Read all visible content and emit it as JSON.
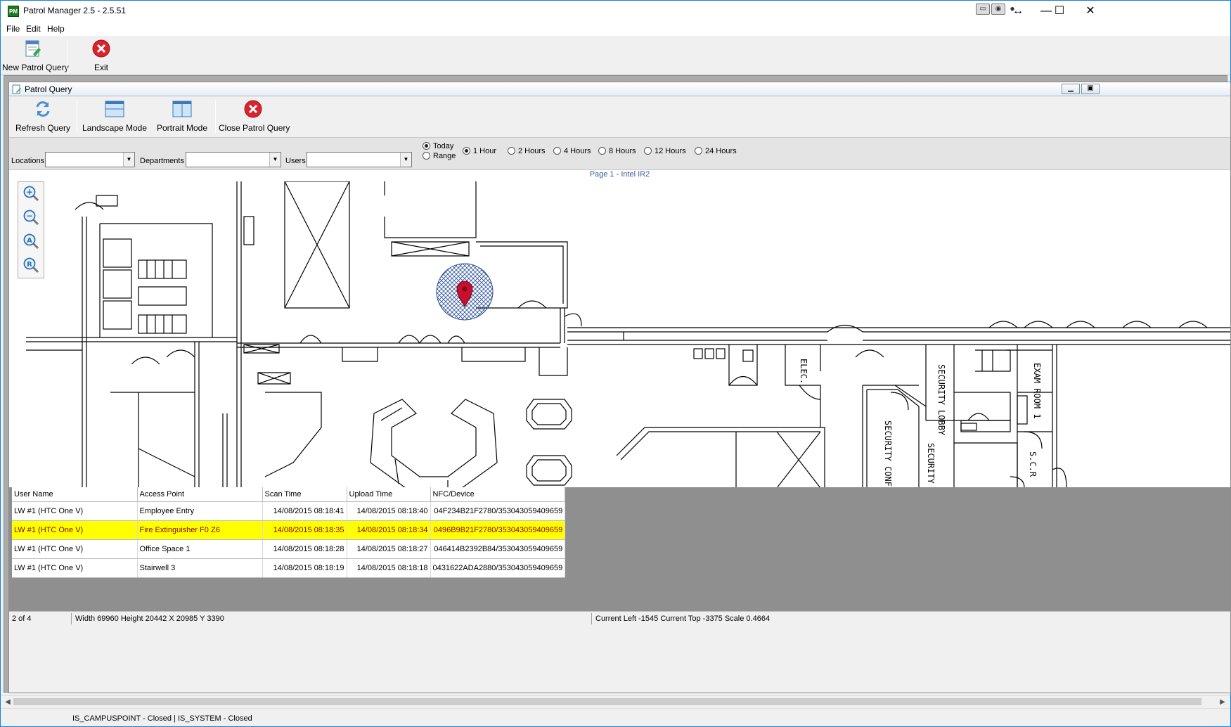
{
  "window": {
    "title": "Patrol Manager 2.5 - 2.5.51",
    "app_icon": "PM",
    "controls": {
      "minimize": "—",
      "maximize": "☐",
      "close": "✕",
      "resize": "↔"
    }
  },
  "menu": {
    "items": [
      "File",
      "Edit",
      "Help"
    ]
  },
  "main_toolbar": {
    "new_patrol_query": "New Patrol Query",
    "exit": "Exit"
  },
  "child_window": {
    "title": "Patrol Query",
    "toolbar": {
      "refresh": "Refresh Query",
      "landscape": "Landscape Mode",
      "portrait": "Portrait Mode",
      "close": "Close Patrol Query"
    },
    "filters": {
      "locations_label": "Locations",
      "locations_value": "",
      "departments_label": "Departments",
      "departments_value": "",
      "users_label": "Users",
      "users_value": "",
      "date_mode": {
        "today": "Today",
        "range": "Range",
        "selected": "Today"
      },
      "time_ranges": [
        "1 Hour",
        "2 Hours",
        "4 Hours",
        "8 Hours",
        "12 Hours",
        "24 Hours"
      ],
      "selected_time_range": "1 Hour"
    },
    "map": {
      "page_caption": "Page 1 - Intel IR2",
      "zoom_buttons": [
        "zoom-in",
        "zoom-out",
        "zoom-all",
        "zoom-reset"
      ],
      "zoom_glyphs": [
        "+",
        "−",
        "A",
        "R"
      ],
      "room_labels": [
        "ELEC.",
        "SECURITY LOBBY",
        "EXAM ROOM 1",
        "SECURITY CONF RM",
        "SECURITY RM",
        "S.C.R"
      ]
    },
    "grid": {
      "columns": [
        "User Name",
        "Access Point",
        "Scan Time",
        "Upload Time",
        "NFC/Device"
      ],
      "rows": [
        {
          "user": "LW #1 (HTC One V)",
          "access_point": "Employee Entry",
          "scan_time": "14/08/2015 08:18:41",
          "upload_time": "14/08/2015 08:18:40",
          "nfc_device": "04F234B21F2780/353043059409659",
          "highlighted": false
        },
        {
          "user": "LW #1 (HTC One V)",
          "access_point": "Fire Extinguisher F0 Z6",
          "scan_time": "14/08/2015 08:18:35",
          "upload_time": "14/08/2015 08:18:34",
          "nfc_device": "0496B9B21F2780/353043059409659",
          "highlighted": true
        },
        {
          "user": "LW #1 (HTC One V)",
          "access_point": "Office Space 1",
          "scan_time": "14/08/2015 08:18:28",
          "upload_time": "14/08/2015 08:18:27",
          "nfc_device": "046414B2392B84/353043059409659",
          "highlighted": false
        },
        {
          "user": "LW #1 (HTC One V)",
          "access_point": "Stairwell 3",
          "scan_time": "14/08/2015 08:18:19",
          "upload_time": "14/08/2015 08:18:18",
          "nfc_device": "0431622ADA2880/353043059409659",
          "highlighted": false
        }
      ]
    },
    "status": {
      "record": "2 of 4",
      "dimensions": "Width 69960 Height 20442 X 20985 Y 3390",
      "position": "Current Left -1545 Current Top -3375 Scale 0.4664"
    }
  },
  "bottom_status": {
    "connections": "IS_CAMPUSPOINT - Closed  |  IS_SYSTEM - Closed"
  },
  "colors": {
    "highlight_row": "#ffff00",
    "marker": "#c8102e",
    "accent_blue": "#1883d7"
  }
}
